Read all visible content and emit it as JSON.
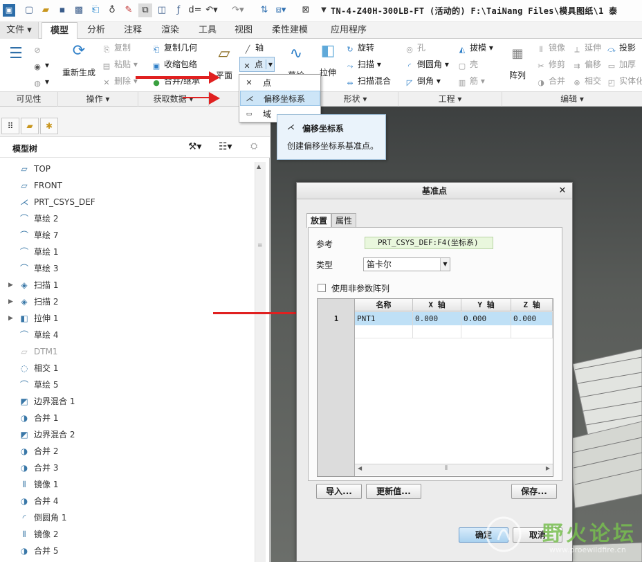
{
  "titlebar": {
    "title": "TN-4-Z40H-300LB-FT (活动的) F:\\TaiNang Files\\模具图纸\\1 泰",
    "icons": [
      "app-icon",
      "new-icon",
      "open-icon",
      "save-icon",
      "save-copy-icon",
      "regenerate-icon",
      "bulb-icon",
      "display-icon",
      "window-icon",
      "mirror-icon",
      "function-icon",
      "d-equals-icon",
      "undo-icon",
      "redo-icon",
      "switch-icon",
      "dropdown-icon",
      "close-window-icon"
    ]
  },
  "tabs": [
    "文件",
    "模型",
    "分析",
    "注释",
    "渲染",
    "工具",
    "视图",
    "柔性建模",
    "应用程序"
  ],
  "active_tab": "模型",
  "ribbon": {
    "regenerate": "重新生成",
    "copy": "复制",
    "paste": "粘贴",
    "delete": "删除",
    "copy_geometry": "复制几何",
    "shrinkwrap": "收缩包络",
    "merge_inherit": "合并/继承",
    "plane": "平面",
    "axis": "轴",
    "point": "点",
    "sketch": "草绘",
    "extrude": "拉伸",
    "revolve": "旋转",
    "sweep": "扫描",
    "swept_blend": "扫描混合",
    "hole": "孔",
    "round": "倒圆角",
    "chamfer": "倒角",
    "draft": "拔模",
    "shell": "壳",
    "rib": "筋",
    "pattern": "阵列",
    "mirror": "镜像",
    "trim": "修剪",
    "merge": "合并",
    "extend": "延伸",
    "offset": "偏移",
    "intersect": "相交",
    "project": "投影",
    "thicken": "加厚",
    "solidify": "实体化"
  },
  "groups": [
    "可见性",
    "操作 ▾",
    "获取数据 ▾",
    "",
    "形状 ▾",
    "工程 ▾",
    "编辑 ▾"
  ],
  "point_dropdown": {
    "items": [
      "点",
      "偏移坐标系",
      "域"
    ],
    "highlighted": "偏移坐标系"
  },
  "tooltip": {
    "title": "偏移坐标系",
    "description": "创建偏移坐标系基准点。"
  },
  "model_tree": {
    "header": "模型树",
    "items": [
      {
        "label": "TOP",
        "icon": "plane-icon",
        "expandable": false,
        "dim": false
      },
      {
        "label": "FRONT",
        "icon": "plane-icon",
        "expandable": false,
        "dim": false
      },
      {
        "label": "PRT_CSYS_DEF",
        "icon": "csys-icon",
        "expandable": false,
        "dim": false
      },
      {
        "label": "草绘 2",
        "icon": "sketch-icon",
        "expandable": false,
        "dim": false
      },
      {
        "label": "草绘 7",
        "icon": "sketch-icon",
        "expandable": false,
        "dim": false
      },
      {
        "label": "草绘 1",
        "icon": "sketch-icon",
        "expandable": false,
        "dim": false
      },
      {
        "label": "草绘 3",
        "icon": "sketch-icon",
        "expandable": false,
        "dim": false
      },
      {
        "label": "扫描 1",
        "icon": "sweep-icon",
        "expandable": true,
        "dim": false
      },
      {
        "label": "扫描 2",
        "icon": "sweep-icon",
        "expandable": true,
        "dim": false
      },
      {
        "label": "拉伸 1",
        "icon": "extrude-icon",
        "expandable": true,
        "dim": false
      },
      {
        "label": "草绘 4",
        "icon": "sketch-icon",
        "expandable": false,
        "dim": false
      },
      {
        "label": "DTM1",
        "icon": "plane-icon",
        "expandable": false,
        "dim": true
      },
      {
        "label": "相交 1",
        "icon": "intersect-icon",
        "expandable": false,
        "dim": false
      },
      {
        "label": "草绘 5",
        "icon": "sketch-icon",
        "expandable": false,
        "dim": false
      },
      {
        "label": "边界混合 1",
        "icon": "boundary-blend-icon",
        "expandable": false,
        "dim": false
      },
      {
        "label": "合并 1",
        "icon": "merge-icon",
        "expandable": false,
        "dim": false
      },
      {
        "label": "边界混合 2",
        "icon": "boundary-blend-icon",
        "expandable": false,
        "dim": false
      },
      {
        "label": "合并 2",
        "icon": "merge-icon",
        "expandable": false,
        "dim": false
      },
      {
        "label": "合并 3",
        "icon": "merge-icon",
        "expandable": false,
        "dim": false
      },
      {
        "label": "镜像 1",
        "icon": "mirror-icon",
        "expandable": false,
        "dim": false
      },
      {
        "label": "合并 4",
        "icon": "merge-icon",
        "expandable": false,
        "dim": false
      },
      {
        "label": "倒圆角 1",
        "icon": "round-icon",
        "expandable": false,
        "dim": false
      },
      {
        "label": "镜像 2",
        "icon": "mirror-icon",
        "expandable": false,
        "dim": false
      },
      {
        "label": "合并 5",
        "icon": "merge-icon",
        "expandable": false,
        "dim": false
      }
    ]
  },
  "dialog": {
    "title": "基准点",
    "tabs": [
      "放置",
      "属性"
    ],
    "active_tab": "放置",
    "reference_label": "参考",
    "reference_value": "PRT_CSYS_DEF:F4(坐标系)",
    "type_label": "类型",
    "type_value": "笛卡尔",
    "checkbox_label": "使用非参数阵列",
    "checkbox_checked": false,
    "table": {
      "columns": [
        "名称",
        "X 轴",
        "Y 轴",
        "Z 轴"
      ],
      "rows": [
        {
          "index": "1",
          "name": "PNT1",
          "x": "0.000",
          "y": "0.000",
          "z": "0.000"
        }
      ]
    },
    "import_button": "导入...",
    "update_button": "更新值...",
    "save_button": "保存...",
    "ok_button": "确定",
    "cancel_button": "取消"
  },
  "watermark": {
    "text": "野火论坛",
    "url": "www.proewildfire.cn"
  },
  "colors": {
    "highlight": "#cde5f7",
    "selected_row": "#bfe0f6",
    "annotation_arrow": "#e02020",
    "reference_field": "#e9f7dd",
    "graphics_bg": "#585b58"
  }
}
